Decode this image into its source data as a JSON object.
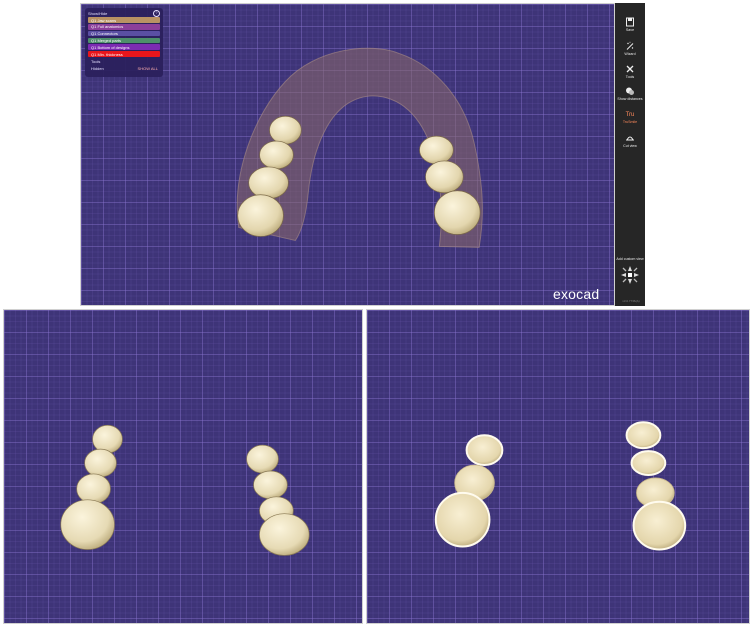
{
  "show_hide": {
    "title": "Show/Hide",
    "help_icon": "help-icon",
    "items": [
      {
        "label": "Q1 Jaw scans",
        "color": "#b99263"
      },
      {
        "label": "Q1 Full anatomics",
        "color": "#8b3f9a"
      },
      {
        "label": "Q1 Connectors",
        "color": "#5a4fa3"
      },
      {
        "label": "Q1 Merged parts",
        "color": "#4d8f6a"
      },
      {
        "label": "Q1 Bottom of designs",
        "color": "#7c2bb2"
      },
      {
        "label": "Q1 Min. thickness",
        "color": "#e8161b"
      }
    ],
    "tools_label": "Tools",
    "hidden_label": "Hidden",
    "show_all_label": "SHOW ALL"
  },
  "toolbar": {
    "items": [
      {
        "label": "Save",
        "icon": "save-icon"
      },
      {
        "label": "Wizard",
        "icon": "wizard-icon"
      },
      {
        "label": "Tools",
        "icon": "tools-icon"
      },
      {
        "label": "Show distances",
        "icon": "distances-icon"
      },
      {
        "label": "TruSmile",
        "icon": "trusmile-icon",
        "color": "#ff8a5c"
      },
      {
        "label": "Cut view",
        "icon": "cut-view-icon"
      }
    ],
    "add_custom_view": "Add custom view",
    "version": "v3.0.7736(A)"
  },
  "brand": {
    "logo": "exocad"
  },
  "colors": {
    "viewport_bg": "#3e3478",
    "grid": "#8c78d2",
    "tooth": "#e7dcb8",
    "gum_overlay": "#8b6a6a"
  }
}
